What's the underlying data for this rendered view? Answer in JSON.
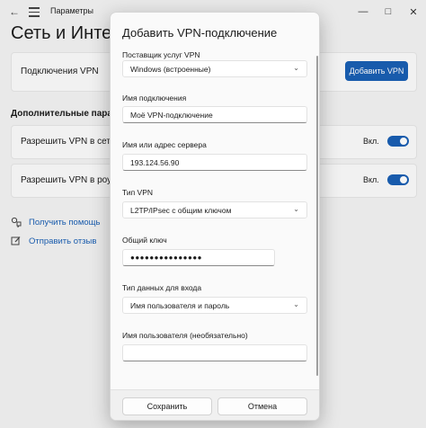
{
  "window": {
    "title": "Параметры",
    "back_glyph": "←",
    "controls": [
      "—",
      "□",
      "✕"
    ]
  },
  "page": {
    "title": "Сеть и Интернет"
  },
  "vpn_card": {
    "label": "Подключения VPN",
    "add_button": "Добавить VPN"
  },
  "advanced": {
    "title": "Дополнительные параметры",
    "toggles": [
      {
        "label": "Разрешить VPN в сетях с",
        "state_text": "Вкл.",
        "on": true
      },
      {
        "label": "Разрешить VPN в роуминге",
        "state_text": "Вкл.",
        "on": true
      }
    ]
  },
  "help": {
    "get_help": "Получить помощь",
    "feedback": "Отправить отзыв"
  },
  "dialog": {
    "title": "Добавить VPN-подключение",
    "provider_label": "Поставщик услуг VPN",
    "provider_value": "Windows (встроенные)",
    "name_label": "Имя подключения",
    "name_value": "Моё VPN-подключение",
    "server_label": "Имя или адрес сервера",
    "server_value": "193.124.56.90",
    "type_label": "Тип VPN",
    "type_value": "L2TP/IPsec с общим ключом",
    "key_label": "Общий ключ",
    "key_value": "●●●●●●●●●●●●●●●",
    "signin_label": "Тип данных для входа",
    "signin_value": "Имя пользователя и пароль",
    "username_label": "Имя пользователя (необязательно)",
    "username_value": "",
    "save_button": "Сохранить",
    "cancel_button": "Отмена"
  },
  "colors": {
    "accent": "#1a5fb4",
    "link": "#1a5fb4"
  }
}
